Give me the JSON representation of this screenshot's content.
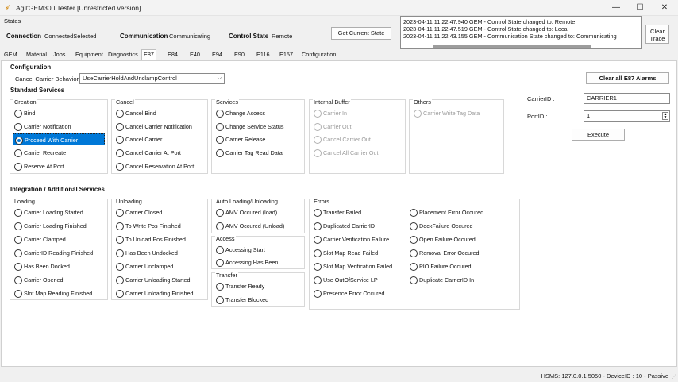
{
  "window": {
    "title": "Agil'GEM300 Tester [Unrestricted version]",
    "minimize": "—",
    "maximize": "☐",
    "close": "✕"
  },
  "states": {
    "label": "States",
    "connection_label": "Connection",
    "connection_value": "ConnectedSelected",
    "communication_label": "Communication",
    "communication_value": "Communicating",
    "control_label": "Control State",
    "control_value": "Remote",
    "get_state_button": "Get Current State"
  },
  "log": {
    "lines": [
      "2023-04-11 11:22:47.940 GEM - Control State changed to: Remote",
      "2023-04-11 11:22:47.519 GEM - Control State changed to: Local",
      "2023-04-11 11:22:43.155 GEM - Communication State changed to: Communicating"
    ],
    "clear_line1": "Clear",
    "clear_line2": "Trace"
  },
  "tabs": [
    "GEM",
    "Material",
    "Jobs",
    "Equipment",
    "Diagnostics",
    "E87",
    "E84",
    "E40",
    "E94",
    "E90",
    "E116",
    "E157",
    "Configuration"
  ],
  "active_tab": "E87",
  "configuration": {
    "title": "Configuration",
    "cancel_carrier_label": "Cancel Carrier Behavior :",
    "cancel_carrier_value": "UseCarrierHoldAndUnclampControl",
    "clear_alarms_button": "Clear all E87 Alarms"
  },
  "standard": {
    "title": "Standard Services",
    "creation": {
      "title": "Creation",
      "items": [
        "Bind",
        "Carrier Notification",
        "Proceed With Carrier",
        "Carrier Recreate",
        "Reserve At Port"
      ],
      "selected": "Proceed With Carrier"
    },
    "cancel": {
      "title": "Cancel",
      "items": [
        "Cancel Bind",
        "Cancel Carrier Notification",
        "Cancel Carrier",
        "Cancel Carrier At Port",
        "Cancel Reservation At Port"
      ]
    },
    "services": {
      "title": "Services",
      "items": [
        "Change Access",
        "Change Service Status",
        "Carrier Release",
        "Carrier Tag Read Data"
      ]
    },
    "buffer": {
      "title": "Internal Buffer",
      "items": [
        "Carrier In",
        "Carrier Out",
        "Cancel Carrier Out",
        "Cancel All Carrier Out"
      ]
    },
    "others": {
      "title": "Others",
      "items": [
        "Carrier Write Tag Data"
      ]
    }
  },
  "right_panel": {
    "carrier_id_label": "CarrierID :",
    "carrier_id_value": "CARRIER1",
    "port_id_label": "PortID :",
    "port_id_value": "1",
    "execute_button": "Execute"
  },
  "integration": {
    "title": "Integration / Additional Services",
    "loading": {
      "title": "Loading",
      "items": [
        "Carrier Loading Started",
        "Carrier Loading Finished",
        "Carrier Clamped",
        "CarrierID Reading Finished",
        "Has Been Docked",
        "Carrier Opened",
        "Slot Map Reading Finished"
      ]
    },
    "unloading": {
      "title": "Unloading",
      "items": [
        "Carrier Closed",
        "To Write Pos Finished",
        "To Unload Pos Finished",
        "Has Been Undocked",
        "Carrier Unclamped",
        "Carrier Unloading Started",
        "Carrier Unloading Finished"
      ]
    },
    "auto": {
      "title": "Auto Loading/Unloading",
      "items": [
        "AMV Occured (load)",
        "AMV Occured (Unload)"
      ]
    },
    "access": {
      "title": "Access",
      "items": [
        "Accessing Start",
        "Accessing Has Been"
      ]
    },
    "transfer": {
      "title": "Transfer",
      "items": [
        "Transfer Ready",
        "Transfer Blocked"
      ]
    },
    "errors": {
      "title": "Errors",
      "col1": [
        "Transfer Failed",
        "Duplicated CarrierID",
        "Carrier Verification Failure",
        "Slot Map Read Failed",
        "Slot Map Verification Failed",
        "Use OutOfService LP",
        "Presence Error Occured"
      ],
      "col2": [
        "Placement Error Occured",
        "DockFailure Occured",
        "Open Failure Occured",
        "Removal Error Occured",
        "PIO Failure Occured",
        "Duplicate CarrierID In"
      ]
    }
  },
  "statusbar": {
    "text": "HSMS: 127.0.0.1:5050 - DeviceID : 10 - Passive"
  }
}
